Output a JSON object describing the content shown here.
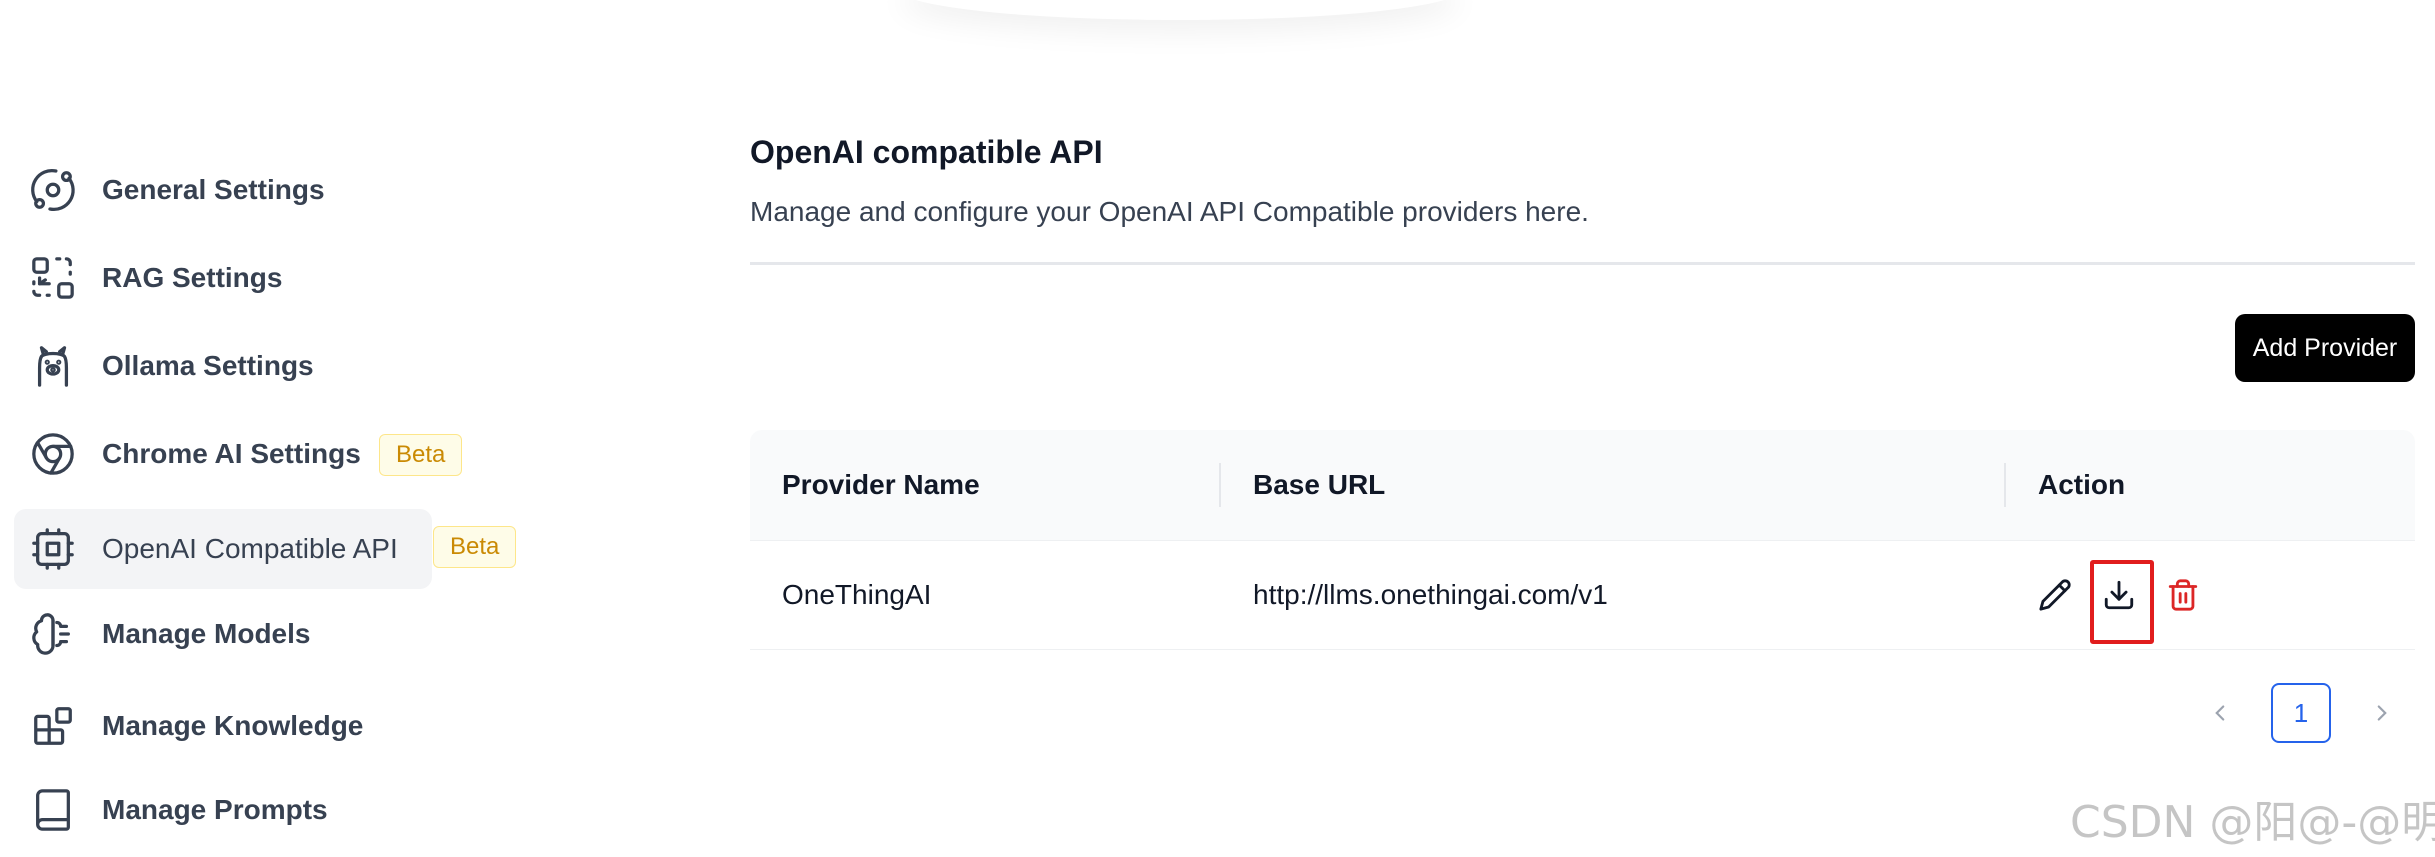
{
  "sidebar": {
    "items": [
      {
        "label": "General Settings",
        "icon": "orbit-icon"
      },
      {
        "label": "RAG Settings",
        "icon": "combine-icon"
      },
      {
        "label": "Ollama Settings",
        "icon": "llama-icon"
      },
      {
        "label": "Chrome AI Settings",
        "icon": "chrome-icon",
        "badge": "Beta"
      },
      {
        "label": "OpenAI Compatible API",
        "icon": "cpu-icon",
        "badge": "Beta",
        "active": true
      },
      {
        "label": "Manage Models",
        "icon": "brain-icon"
      },
      {
        "label": "Manage Knowledge",
        "icon": "blocks-icon"
      },
      {
        "label": "Manage Prompts",
        "icon": "book-icon"
      }
    ]
  },
  "main": {
    "title": "OpenAI compatible API",
    "description": "Manage and configure your OpenAI API Compatible providers here.",
    "add_button": "Add Provider"
  },
  "table": {
    "columns": [
      "Provider Name",
      "Base URL",
      "Action"
    ],
    "rows": [
      {
        "provider_name": "OneThingAI",
        "base_url": "http://llms.onethingai.com/v1"
      }
    ],
    "actions": [
      "pencil-icon",
      "download-icon",
      "trash-icon"
    ]
  },
  "pagination": {
    "current_page": "1"
  },
  "watermark": "CSDN @阳@-@明",
  "colors": {
    "accent": "#2563eb",
    "danger": "#dc2626",
    "highlight": "#e11d1d",
    "badge_text": "#ca8a04"
  }
}
